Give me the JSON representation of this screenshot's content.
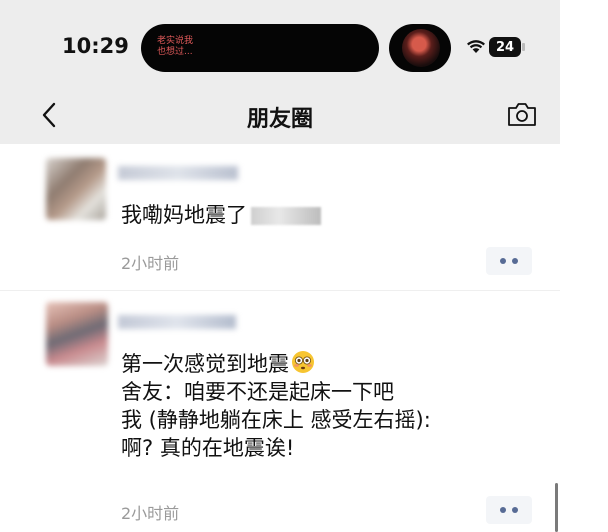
{
  "status_bar": {
    "time": "10:29",
    "island_text_lines": [
      "老实说我",
      "也想过..."
    ],
    "battery": "24"
  },
  "nav": {
    "title": "朋友圈",
    "back_icon": "chevron-left-icon",
    "camera_icon": "camera-icon"
  },
  "posts": [
    {
      "content_lines": [
        "我嘞妈地震了"
      ],
      "time": "2小时前"
    },
    {
      "content_lines": [
        "第一次感觉到地震",
        "舍友：咱要不还是起床一下吧",
        "我 (静静地躺在床上 感受左右摇):",
        "啊? 真的在地震诶!"
      ],
      "emoji": "flushed-face-emoji",
      "time": "2小时前"
    }
  ],
  "colors": {
    "header_bg": "#ededed",
    "link_blue": "#576b95",
    "muted_gray": "#9a9a9a"
  }
}
